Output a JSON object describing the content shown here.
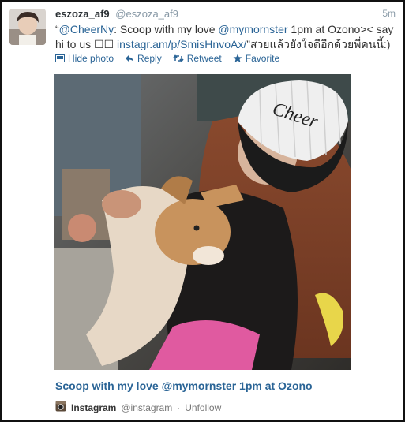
{
  "tweet": {
    "name": "eszoza_af9",
    "handle": "@eszoza_af9",
    "time": "5m",
    "text_quote_open": "“",
    "mention1": "@CheerNy",
    "text_part1": ": Scoop with my love ",
    "mention2": "@mymornster",
    "text_part2": " 1pm at Ozono>< say hi to us ☐☐ ",
    "link": "instagr.am/p/SmisHnvoAx/",
    "text_part3": "”สวยแล้วยังใจดีอีกด้วยพี่คนนี้:)"
  },
  "actions": {
    "hide_photo": "Hide photo",
    "reply": "Reply",
    "retweet": "Retweet",
    "favorite": "Favorite"
  },
  "media": {
    "photo_text": "Cheer",
    "caption": "Scoop with my love @mymornster 1pm at Ozono"
  },
  "source": {
    "app_name": "Instagram",
    "app_handle": "@instagram",
    "separator": "·",
    "unfollow": "Unfollow"
  },
  "colors": {
    "link": "#2a6496",
    "muted": "#8899a6",
    "border": "#111111"
  }
}
